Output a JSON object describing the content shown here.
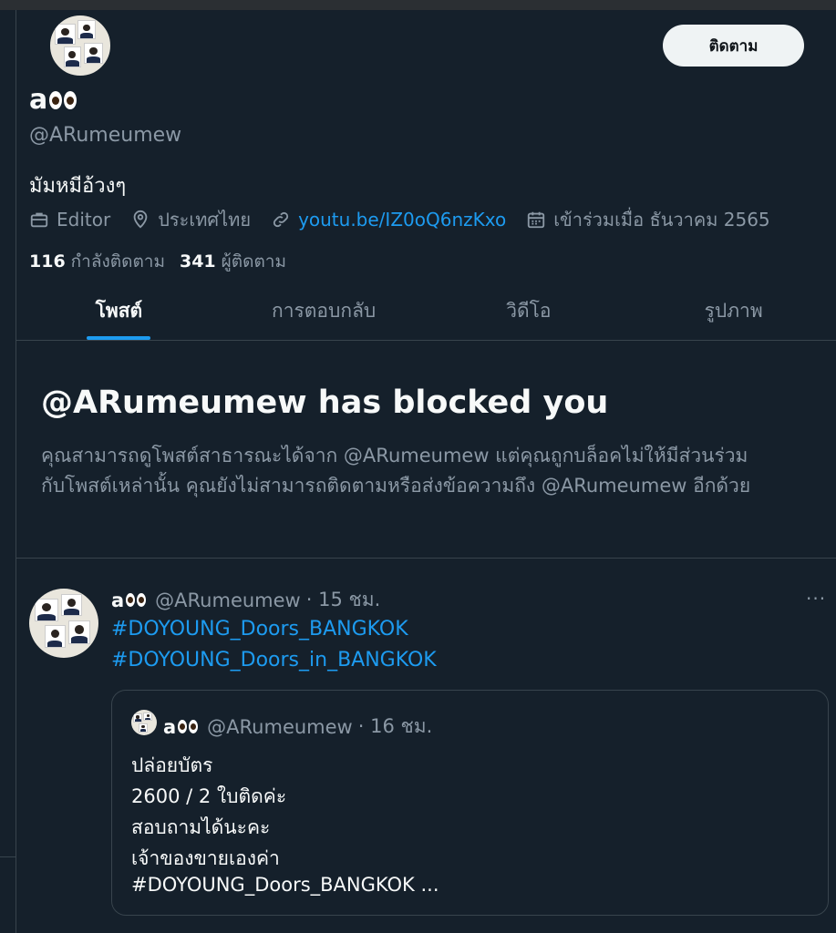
{
  "profile": {
    "display_name": "a",
    "handle": "@ARumeumew",
    "bio": "มัมหมีอ้วงๆ",
    "follow_button": "ติดตาม",
    "meta": {
      "job": "Editor",
      "location": "ประเทศไทย",
      "link": "youtu.be/IZ0oQ6nzKxo",
      "joined": "เข้าร่วมเมื่อ ธันวาคม 2565"
    },
    "following_count": "116",
    "following_label": "กำลังติดตาม",
    "followers_count": "341",
    "followers_label": "ผู้ติดตาม"
  },
  "tabs": [
    {
      "label": "โพสต์",
      "active": true
    },
    {
      "label": "การตอบกลับ",
      "active": false
    },
    {
      "label": "วิดีโอ",
      "active": false
    },
    {
      "label": "รูปภาพ",
      "active": false
    }
  ],
  "blocked": {
    "title": "@ARumeumew has blocked you",
    "line1": "คุณสามารถดูโพสต์สาธารณะได้จาก @ARumeumew แต่คุณถูกบล็อคไม่ให้มีส่วนร่วม",
    "line2": "กับโพสต์เหล่านั้น คุณยังไม่สามารถติดตามหรือส่งข้อความถึง @ARumeumew อีกด้วย"
  },
  "post": {
    "name": "a",
    "handle": "@ARumeumew",
    "time": "· 15 ชม.",
    "more": "···",
    "hashtags": [
      "#DOYOUNG_Doors_BANGKOK",
      "#DOYOUNG_Doors_in_BANGKOK"
    ],
    "quote": {
      "name": "a",
      "handle": "@ARumeumew",
      "time": "· 16 ชม.",
      "lines": [
        "ปล่อยบัตร",
        "2600 / 2 ใบติดค่ะ",
        "สอบถามได้นะคะ",
        "เจ้าของขายเองค่า",
        "#DOYOUNG_Doors_BANGKOK ..."
      ]
    }
  },
  "colors": {
    "background": "#15202b",
    "accent": "#1d9bf0",
    "secondary_text": "#8b98a5",
    "border": "#38444d"
  }
}
